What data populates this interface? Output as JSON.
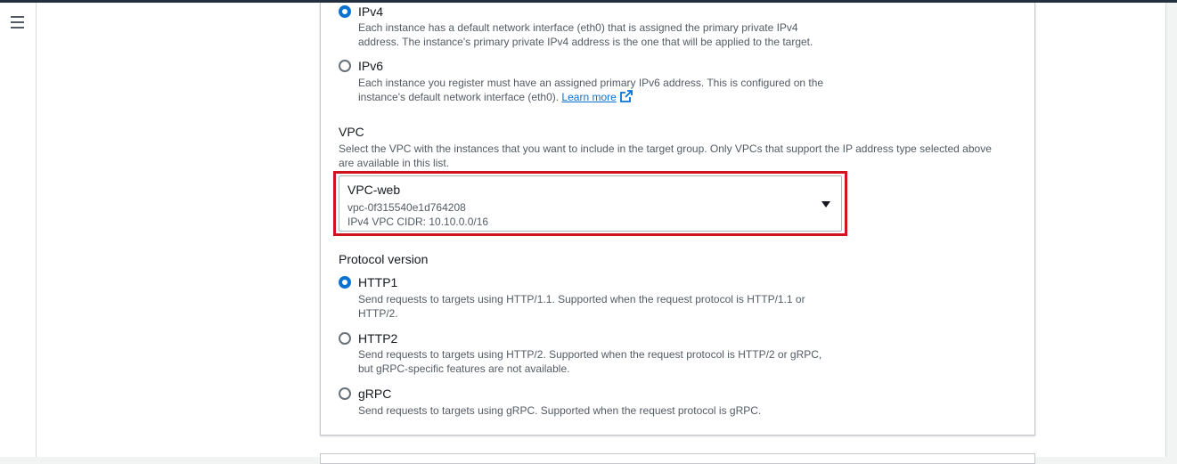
{
  "nav": {
    "menu_icon": "hamburger-menu-icon"
  },
  "ip_type": {
    "options": [
      {
        "label": "IPv4",
        "checked": true,
        "description": [
          "Each instance has a default network interface (eth0) that is assigned the primary private IPv4",
          "address. The instance's primary private IPv4 address is the one that will be applied to the target."
        ]
      },
      {
        "label": "IPv6",
        "checked": false,
        "description": [
          "Each instance you register must have an assigned primary IPv6 address. This is configured on the",
          "instance's default network interface (eth0)."
        ],
        "link_text": "Learn more",
        "link_icon": "external-link-icon"
      }
    ]
  },
  "vpc": {
    "label": "VPC",
    "description": [
      "Select the VPC with the instances that you want to include in the target group. Only VPCs that support the IP address type selected above",
      "are available in this list."
    ],
    "selected": {
      "name": "VPC-web",
      "id": "vpc-0f315540e1d764208",
      "cidr": "IPv4 VPC CIDR: 10.10.0.0/16"
    },
    "highlight_color": "#d0141f"
  },
  "protocol": {
    "label": "Protocol version",
    "options": [
      {
        "label": "HTTP1",
        "checked": true,
        "description": [
          "Send requests to targets using HTTP/1.1. Supported when the request protocol is HTTP/1.1 or",
          "HTTP/2."
        ]
      },
      {
        "label": "HTTP2",
        "checked": false,
        "description": [
          "Send requests to targets using HTTP/2. Supported when the request protocol is HTTP/2 or gRPC,",
          "but gRPC-specific features are not available."
        ]
      },
      {
        "label": "gRPC",
        "checked": false,
        "description": [
          "Send requests to targets using gRPC. Supported when the request protocol is gRPC."
        ]
      }
    ]
  },
  "colors": {
    "accent": "#0972d3",
    "text": "#16191f",
    "muted": "#545b64",
    "background": "#f2f3f3"
  }
}
